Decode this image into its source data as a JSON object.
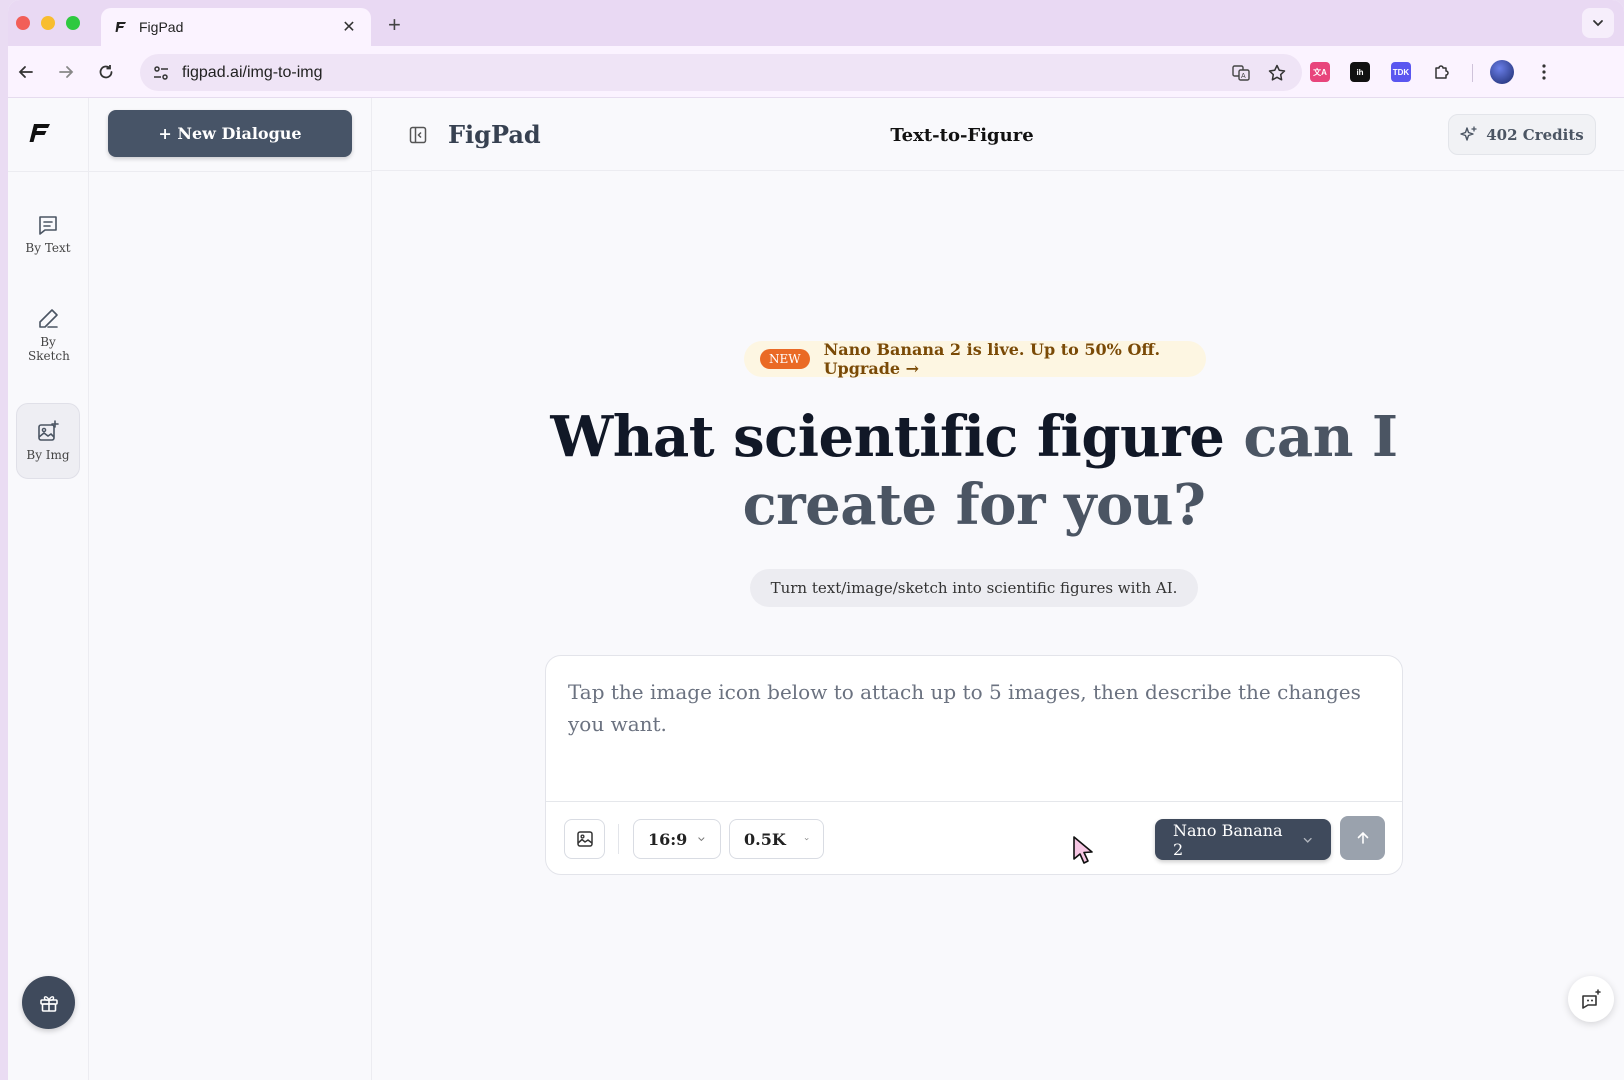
{
  "browser": {
    "tab_title": "FigPad",
    "url": "figpad.ai/img-to-img"
  },
  "rail": {
    "items": [
      {
        "label": "By Text",
        "icon": "message-icon"
      },
      {
        "label": "By Sketch",
        "icon": "pencil-icon"
      },
      {
        "label": "By Img",
        "icon": "image-plus-icon",
        "active": true
      }
    ]
  },
  "sidebar": {
    "new_dialogue_label": "+ New Dialogue"
  },
  "header": {
    "brand": "FigPad",
    "title": "Text-to-Figure",
    "credits": "402 Credits"
  },
  "promo": {
    "badge": "NEW",
    "text": "Nano Banana 2 is live. Up to 50% Off. Upgrade →"
  },
  "hero": {
    "line1_dark": "What scientific figure",
    "line1_muted": "can I",
    "line2_muted": "create for you?"
  },
  "subtitle": "Turn text/image/sketch into scientific figures with AI.",
  "composer": {
    "placeholder": "Tap the image icon below to attach up to 5 images, then describe the changes you want.",
    "aspect_ratio": "16:9",
    "resolution": "0.5K",
    "model": "Nano Banana 2"
  },
  "colors": {
    "primary": "#475467",
    "promo_badge": "#ea6a25",
    "promo_text": "#7a4a06"
  }
}
